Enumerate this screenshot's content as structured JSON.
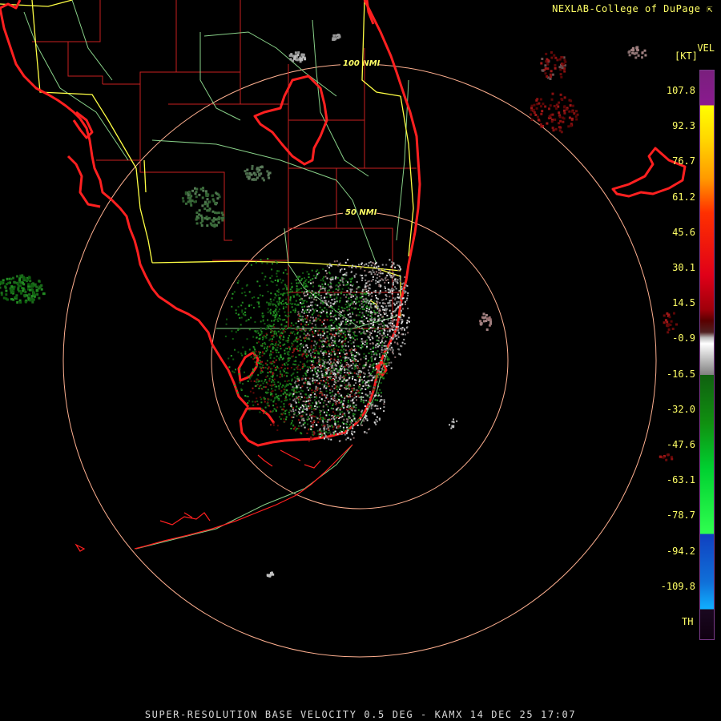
{
  "header": {
    "credit": "NEXLAB-College of DuPage"
  },
  "footer": {
    "caption": "SUPER-RESOLUTION BASE VELOCITY 0.5 DEG - KAMX 14 DEC 25 17:07"
  },
  "legend": {
    "title": "VEL",
    "units": "[KT]",
    "ticks": [
      "107.8",
      "92.3",
      "76.7",
      "61.2",
      "45.6",
      "30.1",
      "14.5",
      "-0.9",
      "-16.5",
      "-32.0",
      "-47.6",
      "-63.1",
      "-78.7",
      "-94.2",
      "-109.8",
      "TH"
    ]
  },
  "rings": {
    "inner": "50 NMI",
    "outer": "100 NMI"
  },
  "colors": {
    "coast": "#ff2020",
    "state_roads": "#ffff44",
    "county": "#c82020",
    "highway": "#88d088",
    "rings": "#ffb090",
    "labels": "#ffff66"
  }
}
